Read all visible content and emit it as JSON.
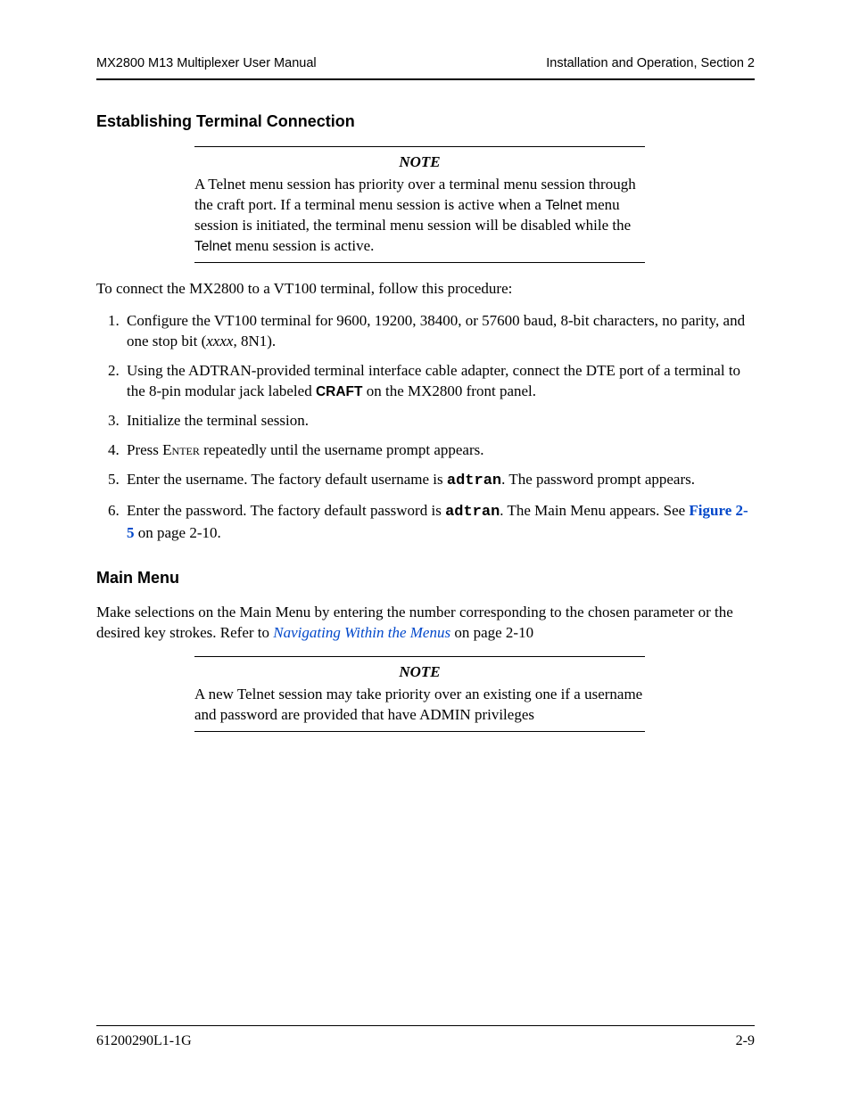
{
  "header": {
    "left": "MX2800 M13 Multiplexer User Manual",
    "right": "Installation and Operation, Section 2"
  },
  "section1": {
    "heading": "Establishing Terminal Connection",
    "note_label": "NOTE",
    "note_a": "A Telnet menu session has priority over a terminal menu session through the craft port. If a terminal menu session is active when a ",
    "note_telnet1": "Telnet",
    "note_b": " menu session is initiated, the terminal menu session will be disabled while the ",
    "note_telnet2": "Telnet",
    "note_c": " menu session is active.",
    "intro": "To connect the MX2800 to a VT100 terminal, follow this procedure:",
    "li1a": "Configure the VT100 terminal for 9600, 19200, 38400, or 57600 baud, 8-bit characters, no parity, and one stop bit (",
    "li1_ital": "xxxx",
    "li1b": ", 8N1).",
    "li2a": "Using the ADTRAN-provided terminal interface cable adapter, connect the DTE port of a terminal to the 8-pin modular jack labeled ",
    "li2_craft": "CRAFT",
    "li2b": " on the MX2800 front panel.",
    "li3": "Initialize the terminal session.",
    "li4a": "Press ",
    "li4_enter": "Enter",
    "li4b": " repeatedly until the username prompt appears.",
    "li5a": "Enter the username. The factory default username is ",
    "li5_user": "adtran",
    "li5b": ". The password prompt appears.",
    "li6a": "Enter the password. The factory default password is ",
    "li6_pass": "adtran",
    "li6b": ". The Main Menu appears. See ",
    "li6_link": "Figure 2-5",
    "li6c": " on page 2-10."
  },
  "section2": {
    "heading": "Main Menu",
    "para_a": "Make selections on the Main Menu by entering the number corresponding to the chosen parameter or the desired key strokes. Refer to ",
    "para_link": "Navigating Within the Menus",
    "para_b": " on page 2-10",
    "note_label": "NOTE",
    "note_body": "A new Telnet session may take priority over an existing one if a username and password are provided that have ADMIN privileges"
  },
  "footer": {
    "left": "61200290L1-1G",
    "right": "2-9"
  }
}
